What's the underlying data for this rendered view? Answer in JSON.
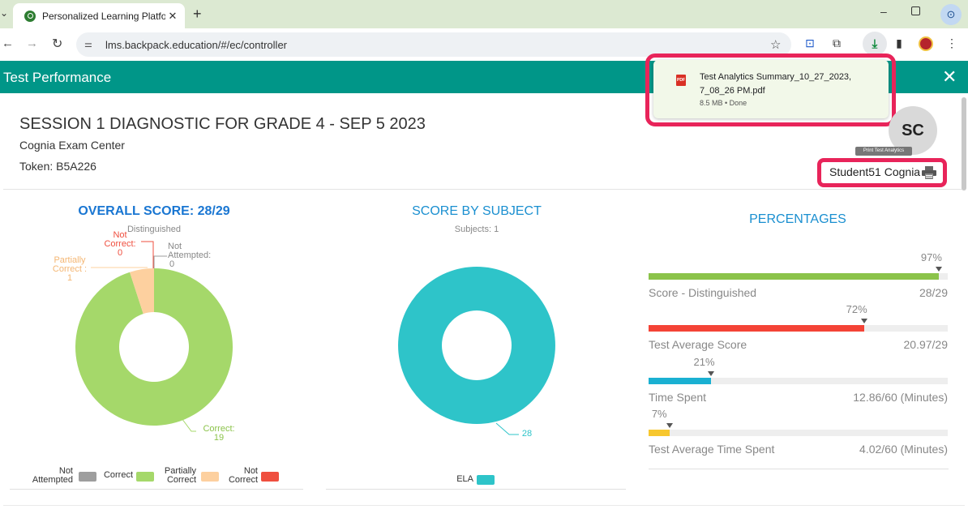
{
  "browser": {
    "tab_title": "Personalized Learning Platform",
    "tab_close": "✕",
    "new_tab": "+",
    "url": "lms.backpack.education/#/ec/controller",
    "site_icon": "tune-icon",
    "accent_color": "#dce9d2"
  },
  "download": {
    "file_name": "Test Analytics Summary_10_27_2023, 7_08_26 PM.pdf",
    "meta": "8.5 MB • Done",
    "icon": "pdf-icon",
    "highlight_color": "#e8245a"
  },
  "header": {
    "title": "Test Performance",
    "close": "✕",
    "color": "#009688"
  },
  "session": {
    "title": "SESSION 1 DIAGNOSTIC FOR GRADE 4 - SEP 5 2023",
    "exam_center": "Cognia Exam Center",
    "token": "Token: B5A226"
  },
  "student": {
    "initials": "SC",
    "name": "Student51 Cognia",
    "tooltip": "Print Test Analytics"
  },
  "overall": {
    "title": "OVERALL SCORE:  28/29",
    "subtitle": "Distinguished",
    "labels": {
      "not_correct": [
        "Not",
        "Correct:",
        "0"
      ],
      "not_attempted": [
        "Not",
        "Attempted:",
        "0"
      ],
      "partially_correct": [
        "Partially",
        "Correct :",
        "1"
      ],
      "correct": [
        "Correct:",
        "19"
      ]
    },
    "legend": [
      {
        "label": [
          "Not",
          "Attempted"
        ],
        "color": "#9e9e9e"
      },
      {
        "label": [
          "Correct"
        ],
        "color": "#a5d86a"
      },
      {
        "label": [
          "Partially",
          "Correct"
        ],
        "color": "#fdd09f"
      },
      {
        "label": [
          "Not",
          "Correct"
        ],
        "color": "#ef4f3f"
      }
    ]
  },
  "chart_data": [
    {
      "type": "pie",
      "title": "OVERALL SCORE:  28/29",
      "subtitle": "Distinguished",
      "categories": [
        "Not Attempted",
        "Correct",
        "Partially Correct",
        "Not Correct"
      ],
      "values": [
        0,
        19,
        1,
        0
      ],
      "colors": [
        "#9e9e9e",
        "#a5d86a",
        "#fdd09f",
        "#ef4f3f"
      ],
      "legend": "bottom"
    },
    {
      "type": "pie",
      "title": "SCORE BY SUBJECT",
      "subtitle": "Subjects: 1",
      "categories": [
        "ELA"
      ],
      "values": [
        28
      ],
      "colors": [
        "#2ec4c9"
      ],
      "legend": "bottom"
    }
  ],
  "subject": {
    "title": "SCORE BY SUBJECT",
    "subtitle": "Subjects: 1",
    "value_label": "28",
    "legend_label": "ELA",
    "color": "#2ec4c9"
  },
  "percentages": {
    "title": "PERCENTAGES",
    "rows": [
      {
        "pct": "97%",
        "fraction": 0.97,
        "label": "Score - Distinguished",
        "right": "28/29",
        "color": "#8bc34a"
      },
      {
        "pct": "72%",
        "fraction": 0.72,
        "label": "Test Average Score",
        "right": "20.97/29",
        "color": "#f44336"
      },
      {
        "pct": "21%",
        "fraction": 0.21,
        "label": "Time Spent",
        "right": "12.86/60 (Minutes)",
        "color": "#1ab0d2"
      },
      {
        "pct": "7%",
        "fraction": 0.07,
        "label": "Test Average Time Spent",
        "right": "4.02/60 (Minutes)",
        "color": "#f7c72e"
      }
    ]
  }
}
